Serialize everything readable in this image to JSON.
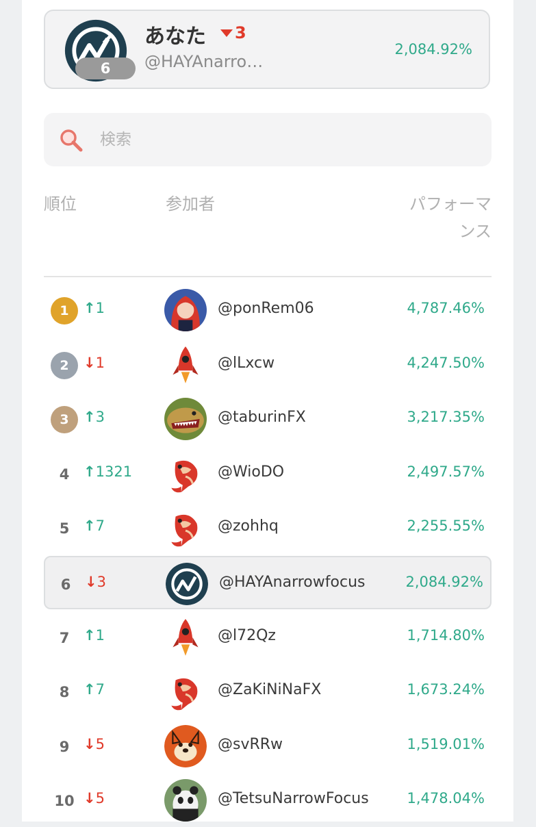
{
  "you": {
    "name": "あなた",
    "change": "3",
    "handle": "@HAYAnarro…",
    "performance": "2,084.92%",
    "rank": "6"
  },
  "search": {
    "placeholder": "検索"
  },
  "headers": {
    "rank": "順位",
    "participant": "参加者",
    "performance": "パフォーマンス"
  },
  "rows": [
    {
      "rank": "1",
      "arrow": "↑",
      "change": "1",
      "dir": "up",
      "handle": "@ponRem06",
      "perf": "4,787.46%",
      "avatar": "anime-girl"
    },
    {
      "rank": "2",
      "arrow": "↓",
      "change": "1",
      "dir": "down",
      "handle": "@lLxcw",
      "perf": "4,247.50%",
      "avatar": "rocket"
    },
    {
      "rank": "3",
      "arrow": "↑",
      "change": "3",
      "dir": "up",
      "handle": "@taburinFX",
      "perf": "3,217.35%",
      "avatar": "dinosaur"
    },
    {
      "rank": "4",
      "arrow": "↑",
      "change": "1321",
      "dir": "up",
      "handle": "@WioDO",
      "perf": "2,497.57%",
      "avatar": "koi"
    },
    {
      "rank": "5",
      "arrow": "↑",
      "change": "7",
      "dir": "up",
      "handle": "@zohhq",
      "perf": "2,255.55%",
      "avatar": "koi"
    },
    {
      "rank": "6",
      "arrow": "↓",
      "change": "3",
      "dir": "down",
      "handle": "@HAYAnarrowfocus",
      "perf": "2,084.92%",
      "avatar": "logo"
    },
    {
      "rank": "7",
      "arrow": "↑",
      "change": "1",
      "dir": "up",
      "handle": "@l72Qz",
      "perf": "1,714.80%",
      "avatar": "rocket"
    },
    {
      "rank": "8",
      "arrow": "↑",
      "change": "7",
      "dir": "up",
      "handle": "@ZaKiNiNaFX",
      "perf": "1,673.24%",
      "avatar": "koi"
    },
    {
      "rank": "9",
      "arrow": "↓",
      "change": "5",
      "dir": "down",
      "handle": "@svRRw",
      "perf": "1,519.01%",
      "avatar": "shiba"
    },
    {
      "rank": "10",
      "arrow": "↓",
      "change": "5",
      "dir": "down",
      "handle": "@TetsuNarrowFocus",
      "perf": "1,478.04%",
      "avatar": "panda"
    }
  ],
  "colors": {
    "up": "#2fa98a",
    "down": "#e03a2a",
    "gold": "#e0a32a",
    "silver": "#9aa3ad",
    "bronze": "#bfa07c"
  }
}
